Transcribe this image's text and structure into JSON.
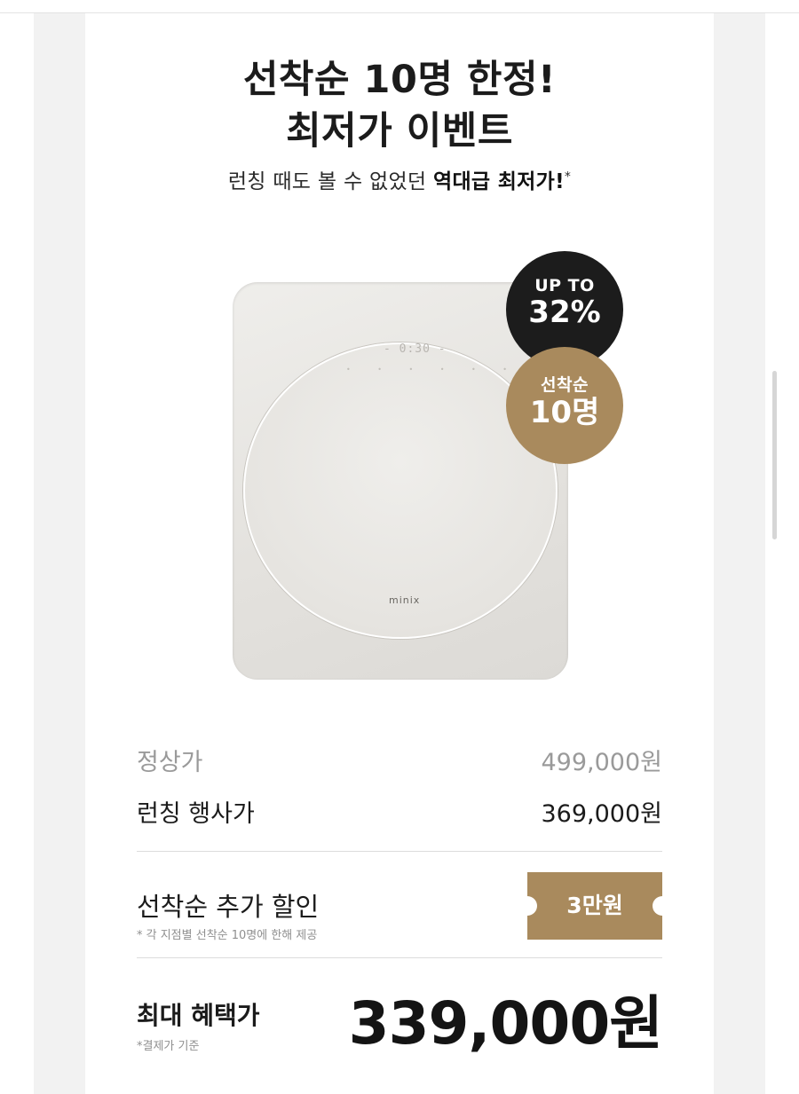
{
  "event": {
    "headline_line1": "선착순 10명 한정!",
    "headline_line2": "최저가 이벤트",
    "subtitle_prefix": "런칭 때도 볼 수 없었던 ",
    "subtitle_emphasis": "역대급 최저가!",
    "subtitle_mark": "*"
  },
  "product": {
    "brand": "minix",
    "display_text": "- 0:30 -"
  },
  "badges": {
    "discount_small": "UP TO",
    "discount_big": "32%",
    "limit_small": "선착순",
    "limit_big": "10명"
  },
  "pricing": {
    "regular_label": "정상가",
    "regular_value": "499,000원",
    "launch_label": "런칭 행사가",
    "launch_value": "369,000원",
    "extra_label": "선착순 추가 할인",
    "extra_note": "* 각 지점별 선착순 10명에 한해 제공",
    "extra_value": "3만원",
    "max_label": "최대 혜택가",
    "max_note": "*결제가 기준",
    "max_value": "339,000원"
  },
  "colors": {
    "accent_gold": "#a98a5d",
    "badge_dark": "#1c1c1c"
  }
}
